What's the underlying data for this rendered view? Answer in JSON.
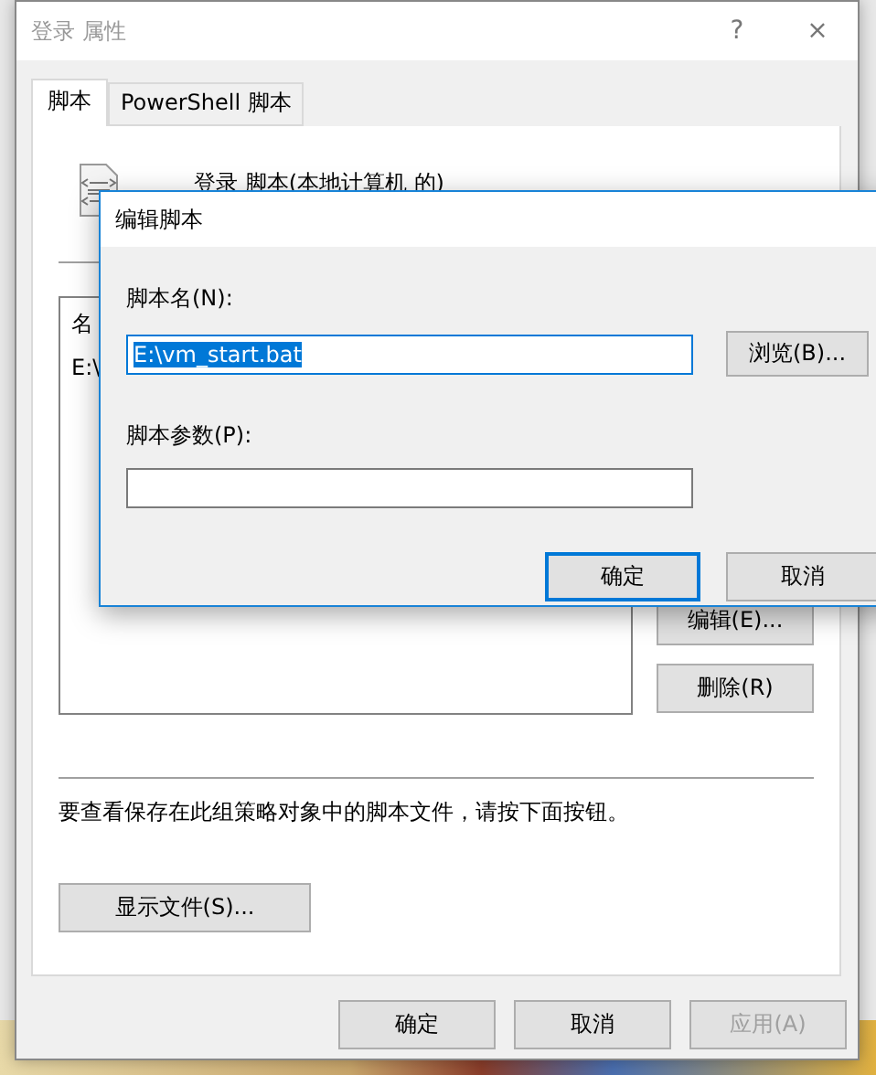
{
  "window": {
    "title": "登录 属性",
    "help": "?",
    "close": "×"
  },
  "tabs": [
    {
      "label": "脚本",
      "selected": true
    },
    {
      "label": "PowerShell 脚本",
      "selected": false
    }
  ],
  "header": "登录 脚本(本地计算机 的)",
  "script_list": {
    "column_1": "名",
    "rows": [
      "E:\\"
    ]
  },
  "side_buttons": [
    {
      "label": "编辑(E)...",
      "disabled": false
    },
    {
      "label": "删除(R)",
      "disabled": false
    }
  ],
  "hint": "要查看保存在此组策略对象中的脚本文件，请按下面按钮。",
  "show_files_button": "显示文件(S)...",
  "buttons": [
    {
      "label": "确定",
      "disabled": false
    },
    {
      "label": "取消",
      "disabled": false
    },
    {
      "label": "应用(A)",
      "disabled": true
    }
  ],
  "dialog": {
    "title": "编辑脚本",
    "name_label": "脚本名(N):",
    "name_value": "E:\\vm_start.bat",
    "name_value_selected": true,
    "browse_button": "浏览(B)...",
    "params_label": "脚本参数(P):",
    "buttons": [
      {
        "label": "确定",
        "default": true
      },
      {
        "label": "取消",
        "default": false
      }
    ]
  }
}
